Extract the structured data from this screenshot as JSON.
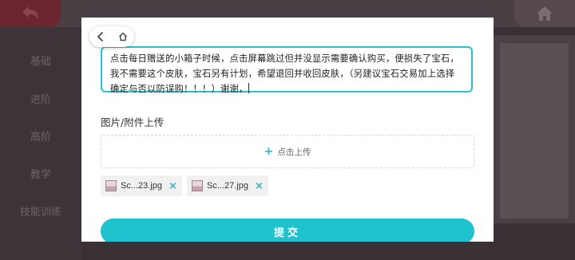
{
  "background": {
    "sidebar_items": [
      "基础",
      "进阶",
      "高阶",
      "教学",
      "技能训练"
    ]
  },
  "nav": {
    "back_icon": "chevron-left-icon",
    "home_icon": "home-icon"
  },
  "form": {
    "description_text": "点击每日赠送的小箱子时候，点击屏幕跳过但并没显示需要确认购买，便损失了宝石，我不需要这个皮肤，宝石另有计划，希望退回并收回皮肤，（另建议宝石交易加上选择确定与否以防误购！！！）谢谢，",
    "upload_section_label": "图片/附件上传",
    "upload_button_label": "点击上传",
    "attachments": [
      {
        "name": "Sc...23.jpg"
      },
      {
        "name": "Sc...27.jpg"
      }
    ],
    "submit_label": "提交"
  },
  "colors": {
    "accent": "#1fc3cd",
    "text_border": "#29c1cc"
  }
}
